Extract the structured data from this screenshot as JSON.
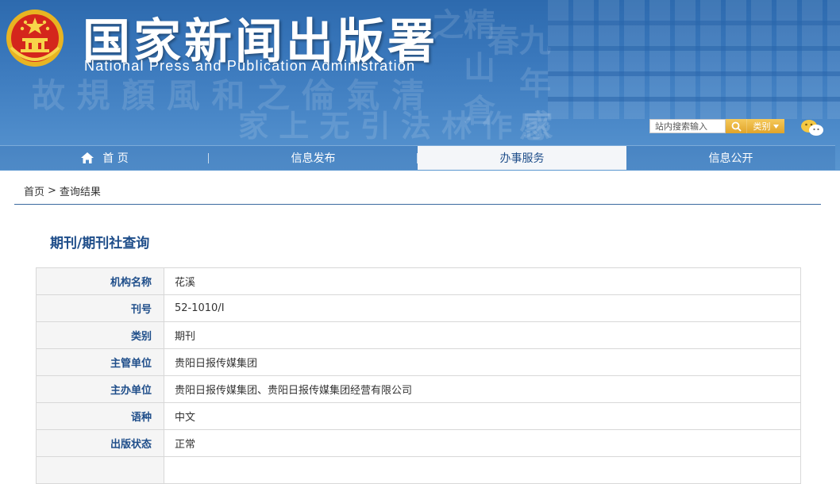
{
  "header": {
    "title": "国家新闻出版署",
    "subtitle": "National  Press and Publication Administration",
    "search_placeholder": "站内搜索输入",
    "category_label": "类别"
  },
  "nav": {
    "items": [
      {
        "label": "首 页"
      },
      {
        "label": "信息发布"
      },
      {
        "label": "办事服务"
      },
      {
        "label": "信息公开"
      }
    ]
  },
  "breadcrumb": {
    "home": "首页",
    "separator": ">",
    "current": "查询结果"
  },
  "main": {
    "section_title": "期刊/期刊社查询",
    "rows": [
      {
        "label": "机构名称",
        "value": "花溪"
      },
      {
        "label": "刊号",
        "value": "52-1010/I"
      },
      {
        "label": "类别",
        "value": "期刊"
      },
      {
        "label": "主管单位",
        "value": "贵阳日报传媒集团"
      },
      {
        "label": "主办单位",
        "value": "贵阳日报传媒集团、贵阳日报传媒集团经营有限公司"
      },
      {
        "label": "语种",
        "value": "中文"
      },
      {
        "label": "出版状态",
        "value": "正常"
      },
      {
        "label": "",
        "value": ""
      }
    ]
  },
  "colors": {
    "header_blue": "#3a78bc",
    "accent_blue": "#1f4e8a",
    "search_button": "#e0a42a",
    "active_tab": "#f4f6f9"
  },
  "icons": [
    "national-emblem-icon",
    "search-icon",
    "dropdown-arrow-icon",
    "wechat-icon",
    "home-icon"
  ]
}
